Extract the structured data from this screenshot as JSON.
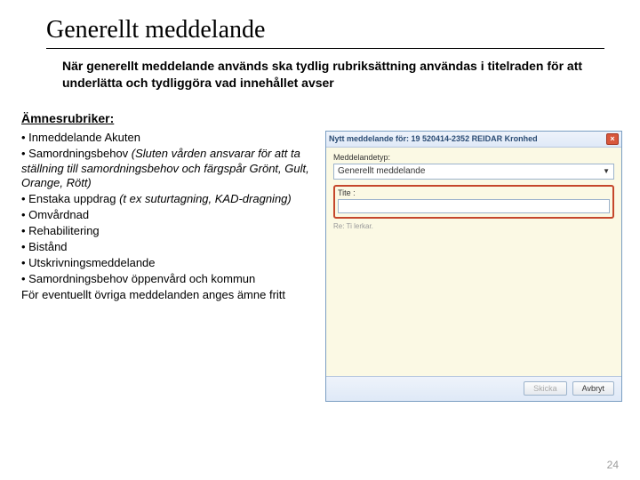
{
  "title": "Generellt meddelande",
  "intro": "När generellt meddelande används ska tydlig rubriksättning användas i titelraden för att underlätta och tydliggöra vad innehållet avser",
  "subhead": "Ämnesrubriker:",
  "bullets": {
    "b1": "• Inmeddelande Akuten",
    "b2a": "• Samordningsbehov ",
    "b2b": "(Sluten vården ansvarar för att ta ställning till samordningsbehov och färgspår Grönt, Gult, Orange, Rött)",
    "b3a": "• Enstaka uppdrag ",
    "b3b": "(t ex suturtagning, KAD-dragning)",
    "b4": "• Omvårdnad",
    "b5": "• Rehabilitering",
    "b6": "• Bistånd",
    "b7": "• Utskrivningsmeddelande",
    "b8": "• Samordningsbehov öppenvård och kommun",
    "tail": "För eventuellt övriga meddelanden anges ämne fritt"
  },
  "app": {
    "title": "Nytt meddelande för: 19 520414-2352 REIDAR Kronhed",
    "type_label": "Meddelandetyp:",
    "type_value": "Generellt meddelande",
    "title_label": "Tite :",
    "title_value": "",
    "hint": "Re: Ti lerkar.",
    "send": "Skicka",
    "cancel": "Avbryt"
  },
  "page_number": "24"
}
